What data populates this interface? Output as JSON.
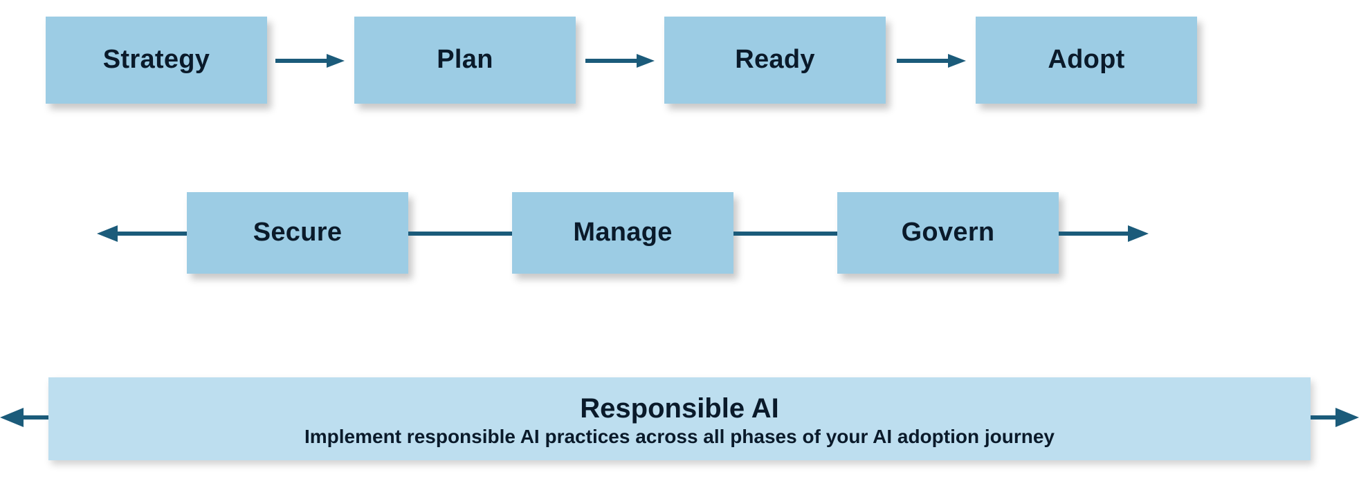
{
  "row1": {
    "strategy": "Strategy",
    "plan": "Plan",
    "ready": "Ready",
    "adopt": "Adopt"
  },
  "row2": {
    "secure": "Secure",
    "manage": "Manage",
    "govern": "Govern"
  },
  "responsible": {
    "title": "Responsible AI",
    "subtitle": "Implement responsible AI practices across all phases of your AI adoption journey"
  },
  "colors": {
    "box_mid": "#9ccce4",
    "box_wide": "#bddeef",
    "arrow": "#1b5b7a"
  }
}
